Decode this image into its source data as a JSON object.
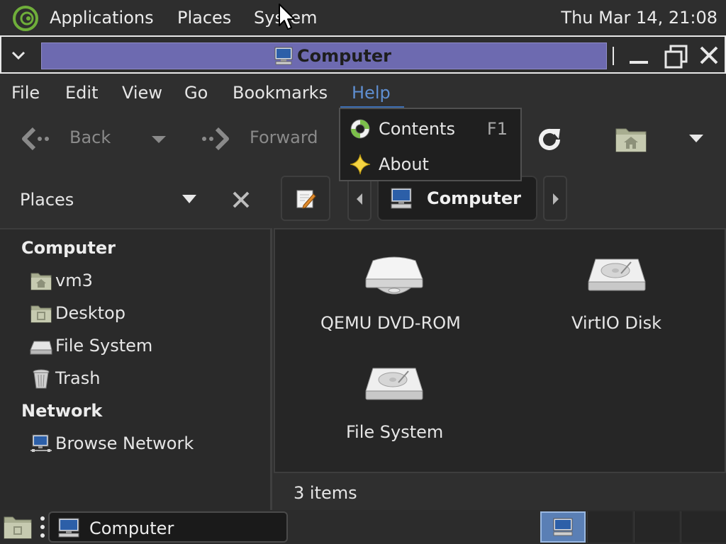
{
  "top_panel": {
    "applications": "Applications",
    "places": "Places",
    "system": "System",
    "clock": "Thu Mar 14, 21:08"
  },
  "window": {
    "title": "Computer"
  },
  "menubar": {
    "file": "File",
    "edit": "Edit",
    "view": "View",
    "go": "Go",
    "bookmarks": "Bookmarks",
    "help": "Help"
  },
  "toolbar": {
    "back": "Back",
    "forward": "Forward"
  },
  "help_menu": {
    "items": [
      {
        "label": "Contents",
        "accel": "F1",
        "icon": "lifebuoy-icon"
      },
      {
        "label": "About",
        "accel": "",
        "icon": "star-icon"
      }
    ]
  },
  "sidebar": {
    "title": "Places",
    "sections": [
      {
        "heading": "Computer",
        "items": [
          {
            "label": "vm3",
            "icon": "home-folder-icon"
          },
          {
            "label": "Desktop",
            "icon": "desktop-folder-icon"
          },
          {
            "label": "File System",
            "icon": "drive-icon"
          },
          {
            "label": "Trash",
            "icon": "trash-icon"
          }
        ]
      },
      {
        "heading": "Network",
        "items": [
          {
            "label": "Browse Network",
            "icon": "network-icon"
          }
        ]
      }
    ]
  },
  "location": {
    "crumb": "Computer"
  },
  "content": {
    "items": [
      {
        "label": "QEMU DVD-ROM",
        "icon": "optical-drive-icon"
      },
      {
        "label": "VirtIO Disk",
        "icon": "hard-disk-icon"
      },
      {
        "label": "File System",
        "icon": "hard-disk-icon"
      }
    ]
  },
  "status": {
    "text": "3 items"
  },
  "taskbar": {
    "task_label": "Computer"
  },
  "colors": {
    "title_active": "#6d6ab0",
    "menu_highlight": "#5f8fd2",
    "workspace_active": "#5a7fb5"
  }
}
